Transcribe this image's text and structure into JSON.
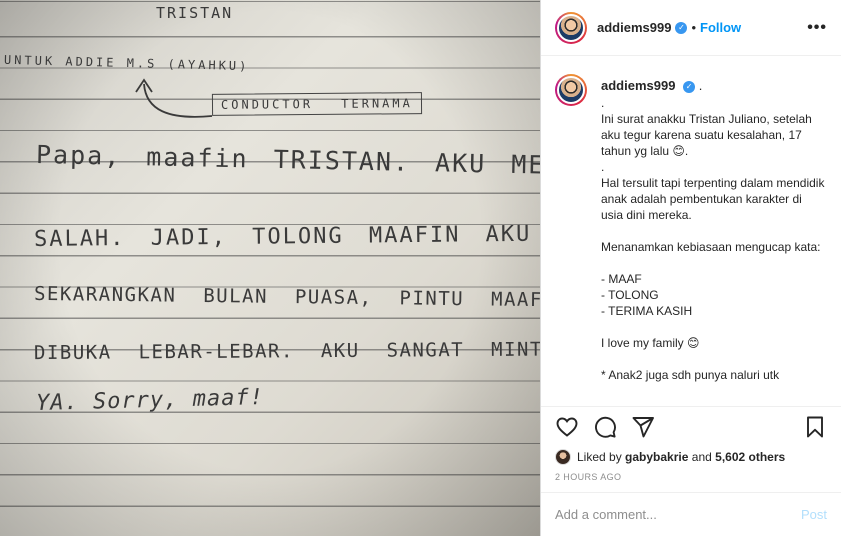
{
  "photo": {
    "letter_lines": [
      "TRISTAN",
      "UNTUK  ADDIE M.S (AYAHKU)",
      "CONDUCTOR TERNAMA",
      "Papa, maafin TRISTAN. AKU MEMANG",
      "SALAH. JADI, TOLONG MAAFIN AKU YA.",
      "SEKARANGKAN BULAN PUASA, PINTU MAAF",
      "DIBUKA LEBAR-LEBAR. AKU SANGAT MINTA MAAF",
      "YA. Sorry, maaf!"
    ]
  },
  "header": {
    "username": "addiems999",
    "follow_label": "Follow",
    "more_label": "•••"
  },
  "caption": {
    "username": "addiems999",
    "first_line": ".",
    "text": ".\nIni surat anakku Tristan Juliano, setelah aku tegur karena suatu kesalahan, 17 tahun yg lalu 😊.\n.\nHal tersulit tapi terpenting dalam mendidik anak adalah pembentukan karakter di usia dini mereka.\n\nMenanamkan kebiasaan mengucap kata:\n\n- MAAF\n- TOLONG\n- TERIMA KASIH\n\nI love my family 😊\n\n* Anak2 juga sdh punya naluri utk"
  },
  "likes": {
    "prefix": "Liked by",
    "liker": "gabybakrie",
    "connector": "and",
    "others": "5,602 others"
  },
  "timestamp": "2 HOURS AGO",
  "comment": {
    "placeholder": "Add a comment...",
    "post_label": "Post"
  },
  "colors": {
    "accent": "#0095f6",
    "verified": "#3897f0",
    "post_disabled": "#b2dffc",
    "muted": "#8e8e8e"
  }
}
